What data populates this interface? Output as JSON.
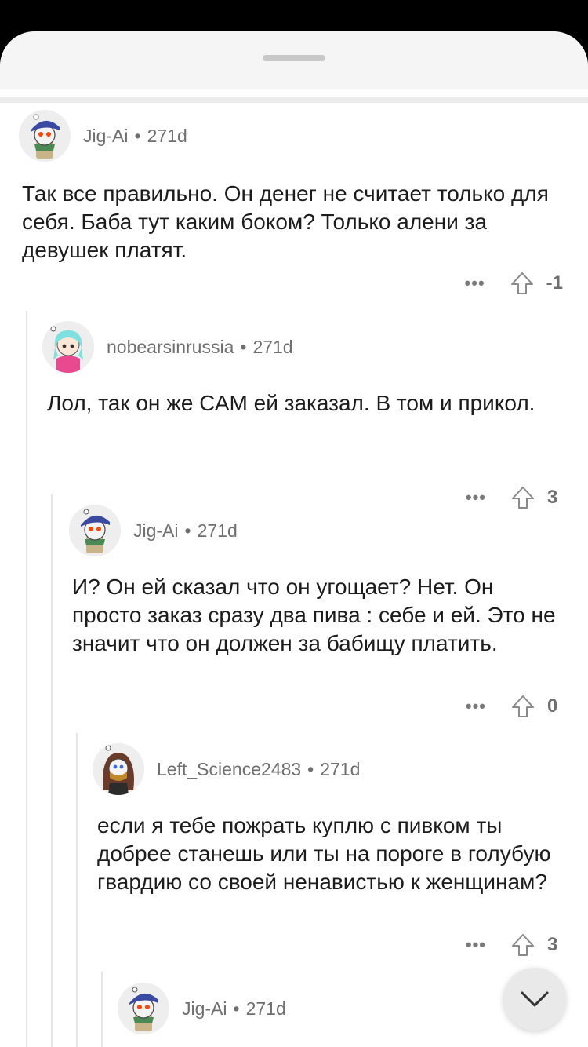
{
  "comments": [
    {
      "user": "Jig-Ai",
      "age": "271d",
      "avatar": "jig-avatar",
      "text": "Так все правильно. Он денег не считает только для себя. Баба тут каким боком?  Только алени за девушек платят.",
      "score": "-1"
    },
    {
      "user": "nobearsinrussia",
      "age": "271d",
      "avatar": "nobear-avatar",
      "text": "Лол, так он же САМ ей заказал. В том и прикол.",
      "score": "3"
    },
    {
      "user": "Jig-Ai",
      "age": "271d",
      "avatar": "jig-avatar",
      "text": "И? Он ей сказал что он угощает? Нет. Он просто заказ сразу два пива : себе и ей. Это не значит что он должен за бабищу платить.",
      "score": "0"
    },
    {
      "user": "Left_Science2483",
      "age": "271d",
      "avatar": "left-science-avatar",
      "text": "если я тебе пожрать куплю с пивком ты добрее станешь или ты на пороге в голубую гвардию со своей ненавистью к женщинам?",
      "score": "3"
    },
    {
      "user": "Jig-Ai",
      "age": "271d",
      "avatar": "jig-avatar"
    }
  ],
  "ui": {
    "dot": "•",
    "more": "•••",
    "colors": {
      "sheet": "#ffffff",
      "header": "#f5f5f5",
      "meta": "#6f6f6f",
      "text": "#1c1c1c"
    }
  }
}
